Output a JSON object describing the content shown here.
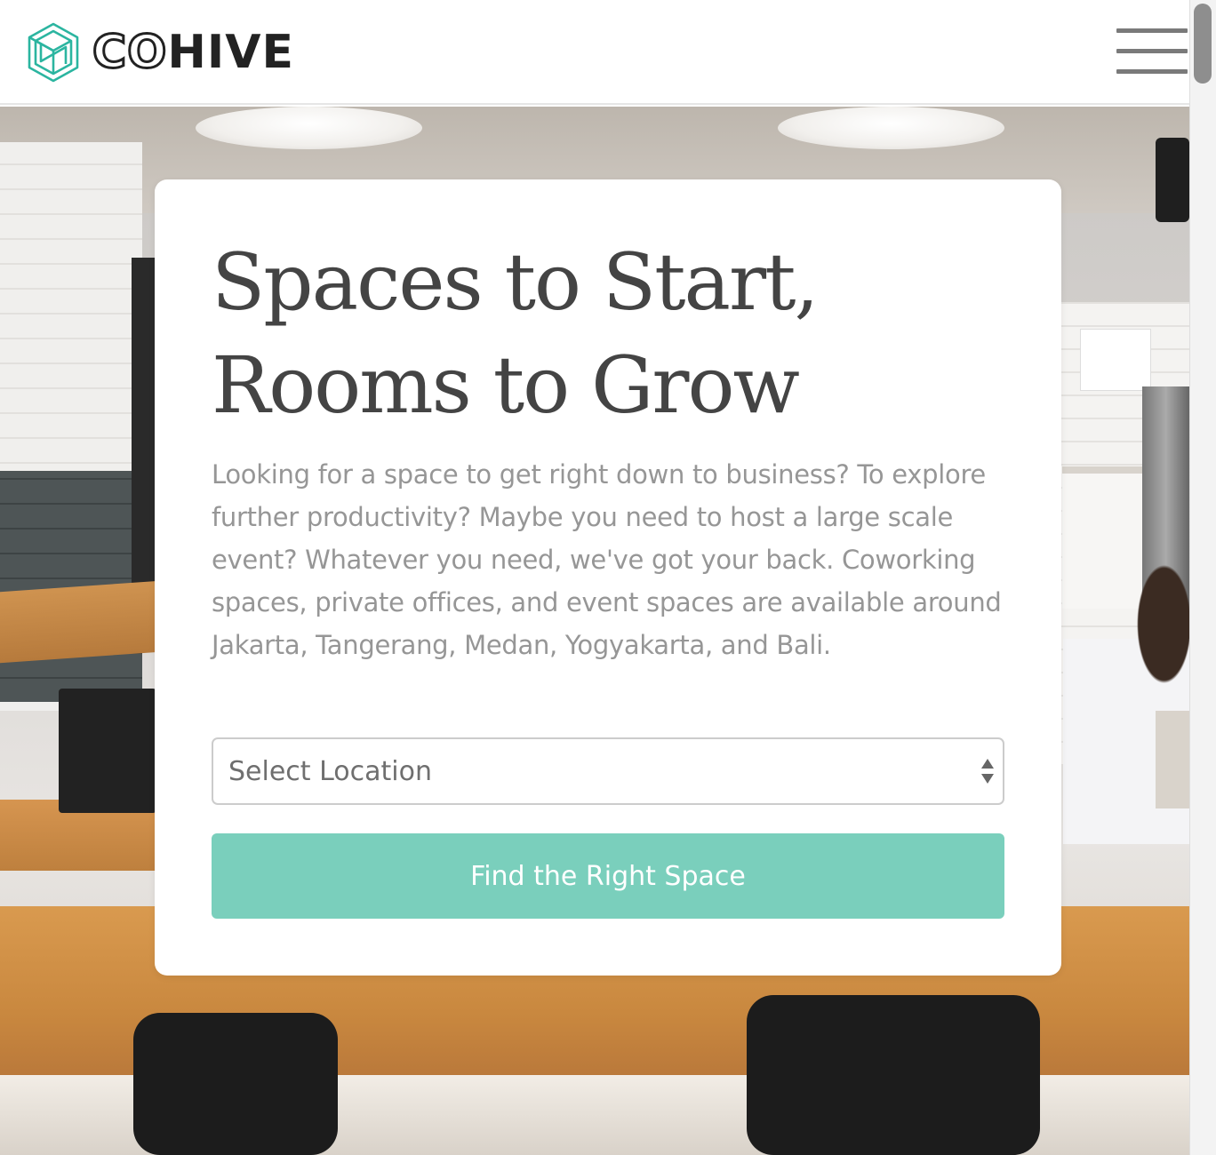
{
  "header": {
    "logo": {
      "co": "CO",
      "hive": "HIVE",
      "mark_icon": "cohive-logo-icon",
      "brand_color": "#2bb5a0"
    },
    "menu_icon": "hamburger-menu-icon"
  },
  "hero": {
    "headline_line1": "Spaces to Start,",
    "headline_line2": "Rooms to Grow",
    "description": "Looking for a space to get right down to business? To explore further productivity? Maybe you need to host a large scale event? Whatever you need, we've got your back. Coworking spaces, private offices, and event spaces are available around Jakarta, Tangerang, Medan, Yogyakarta, and Bali.",
    "location_select": {
      "selected": "Select Location"
    },
    "cta_label": "Find the Right Space",
    "cta_color": "#7acfbc"
  }
}
